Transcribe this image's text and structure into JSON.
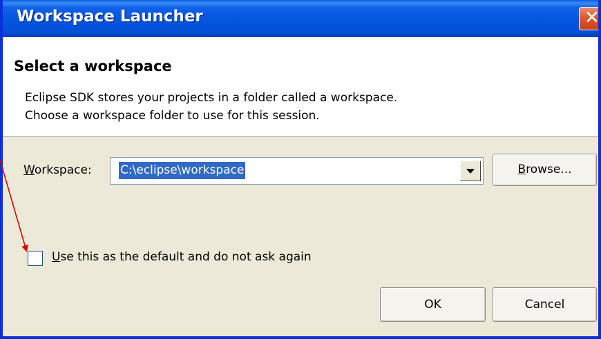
{
  "window": {
    "title": "Workspace Launcher",
    "close_glyph": "✕",
    "close_icon": "close-icon"
  },
  "header": {
    "title": "Select a workspace",
    "description_line1": "Eclipse SDK stores your projects in a folder called a workspace.",
    "description_line2": "Choose a workspace folder to use for this session."
  },
  "workspace": {
    "label_mnemonic": "W",
    "label_rest": "orkspace:",
    "value": "C:\\eclipse\\workspace",
    "dropdown_icon": "chevron-down-icon"
  },
  "buttons": {
    "browse_mnemonic": "B",
    "browse_rest": "rowse...",
    "ok": "OK",
    "cancel": "Cancel"
  },
  "default_option": {
    "label_mnemonic": "U",
    "label_rest": "se this as the default and do not ask again",
    "checked": false
  },
  "annotation": {
    "arrow_color": "#e00000"
  },
  "colors": {
    "titlebar": "#0455e0",
    "dialog_bg": "#ece9d8",
    "selection": "#316ac5",
    "close_button": "#dc5a30"
  }
}
